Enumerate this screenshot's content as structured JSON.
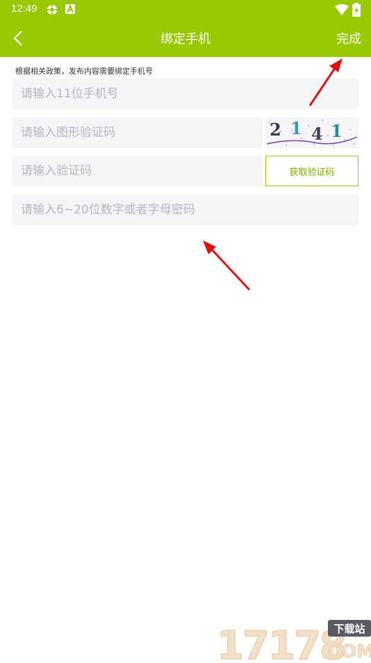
{
  "status_bar": {
    "time": "12:49"
  },
  "app_bar": {
    "title": "绑定手机",
    "done_label": "完成"
  },
  "notice": "根据相关政策，发布内容需要绑定手机号",
  "form": {
    "phone_placeholder": "请输入11位手机号",
    "captcha_placeholder": "请输入图形验证码",
    "captcha_text": "2141",
    "sms_code_placeholder": "请输入验证码",
    "get_code_label": "获取验证码",
    "password_placeholder": "请输入6~20位数字或者字母密码"
  },
  "watermark": {
    "number": "17178",
    "tag": "下载站",
    "suffix": ".COM"
  },
  "colors": {
    "accent": "#97c800",
    "field_bg": "#f5f5f7",
    "annotation_arrow": "#e01010"
  },
  "icons": [
    "back-chevron-icon",
    "settings-gear-icon",
    "a-letter-icon",
    "wifi-icon",
    "battery-icon"
  ]
}
